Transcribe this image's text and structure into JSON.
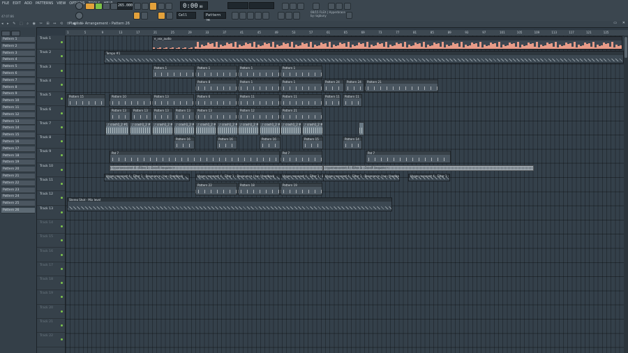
{
  "menu": [
    "FILE",
    "EDIT",
    "ADD",
    "PATTERNS",
    "VIEW",
    "OPTIONS",
    "TOOLS",
    "HELP"
  ],
  "hint": "47:07:86",
  "transport": {
    "tempo": "265.000",
    "time": "0:00",
    "time_cs": "00",
    "pattern": "Pattern 26",
    "snap": "Cell",
    "pat_mode": "PAT",
    "track_label": "Track 21"
  },
  "news": {
    "line1": "08/15 FLEX | Hyperbrace",
    "line2": "by ragbuny"
  },
  "breadcrumb": "Playlist - Arrangement › Pattern 26",
  "patterns": [
    "Pattern 1",
    "Pattern 2",
    "Pattern 3",
    "Pattern 4",
    "Pattern 5",
    "Pattern 6",
    "Pattern 7",
    "Pattern 8",
    "Pattern 9",
    "Pattern 10",
    "Pattern 11",
    "Pattern 12",
    "Pattern 13",
    "Pattern 14",
    "Pattern 15",
    "Pattern 16",
    "Pattern 17",
    "Pattern 18",
    "Pattern 19",
    "Pattern 20",
    "Pattern 21",
    "Pattern 22",
    "Pattern 23",
    "Pattern 24",
    "Pattern 25",
    "Pattern 26"
  ],
  "selected_pattern": "Pattern 26",
  "tracks": [
    "Track 1",
    "Track 2",
    "Track 3",
    "Track 4",
    "Track 5",
    "Track 6",
    "Track 7",
    "Track 8",
    "Track 9",
    "Track 10",
    "Track 11",
    "Track 12",
    "Track 13",
    "Track 14",
    "Track 15",
    "Track 16",
    "Track 17",
    "Track 18",
    "Track 19",
    "Track 20",
    "Track 21",
    "Track 22"
  ],
  "ruler": [
    "1",
    "5",
    "9",
    "13",
    "17",
    "21",
    "25",
    "29",
    "33",
    "37",
    "41",
    "45",
    "49",
    "53",
    "57",
    "61",
    "65",
    "69",
    "73",
    "77",
    "81",
    "85",
    "89",
    "93",
    "97",
    "101",
    "105",
    "109",
    "113",
    "117",
    "121",
    "125"
  ],
  "clip_labels": {
    "audio1": "e_vox_audio",
    "audio2": "Tempo #1",
    "p1": "Pattern 1",
    "p2": "Pattern 2",
    "p3": "Pattern 3",
    "p6": "Pattern 6",
    "p8": "Pattern 8",
    "p10": "Pattern 10",
    "p11": "Pattern 11",
    "p12": "Pattern 12",
    "p13": "Pattern 13",
    "p14": "Pattern 14",
    "p15": "Pattern 15",
    "p16": "Pattern 16",
    "p18": "Pattern 18",
    "p19": "Pattern 19",
    "p20": "Pattern 20",
    "p21": "Pattern 21",
    "p22": "Pattern 22",
    "p23": "Pattern 23",
    "p24": "Pattern 24",
    "p26": "Pattern 26",
    "crash": "♪ crash1_2 #1",
    "pat7": "Pat 7",
    "auto1": "Hyper resonant 4 - Filter 1 - Cutoff frequency",
    "auto2": "Hyper resonant 4 - Filter 1 - Resonance / bw / feedback",
    "auto3": "Stereo Shot - Mix level"
  },
  "colors": {
    "accent": "#e3a13b",
    "play": "#7cc247",
    "waveform": "#e79b88"
  }
}
